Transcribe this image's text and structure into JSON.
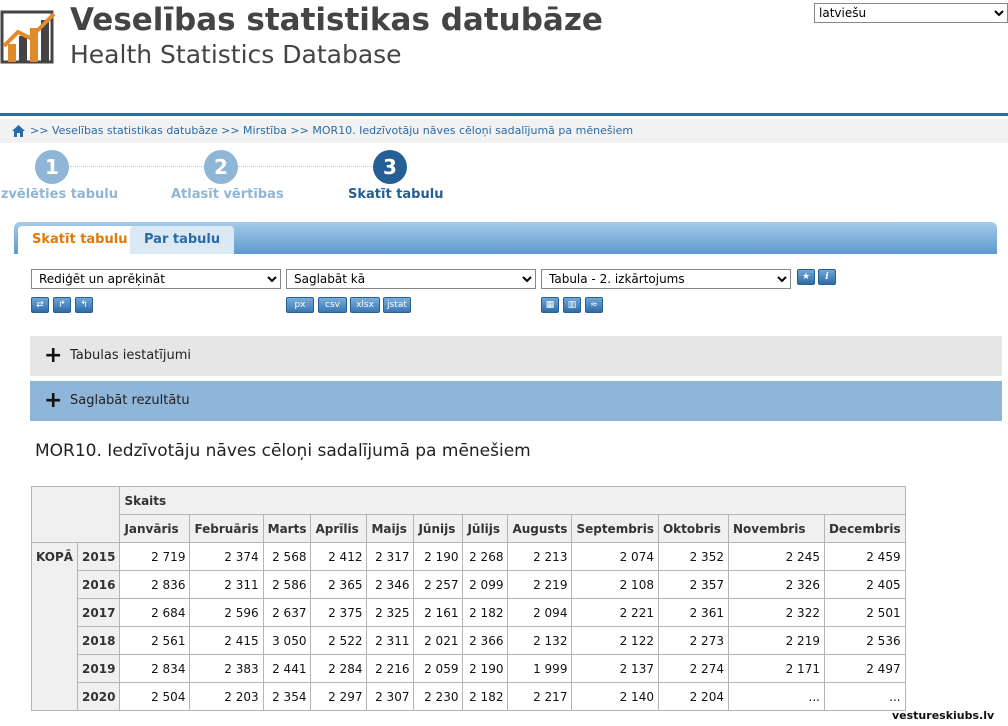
{
  "header": {
    "title_lv": "Veselības statistikas datubāze",
    "title_en": "Health Statistics Database",
    "language_selected": "latviešu"
  },
  "breadcrumb": {
    "path": ">> Veselības statistikas datubāze >> Mirstība >> MOR10. Iedzīvotāju nāves cēloņi sadalījumā pa mēnešiem"
  },
  "steps": [
    {
      "number": "1",
      "label": "Izvēlēties tabulu"
    },
    {
      "number": "2",
      "label": "Atlasīt vērtības"
    },
    {
      "number": "3",
      "label": "Skatīt tabulu"
    }
  ],
  "tabs": {
    "view_table": "Skatīt tabulu",
    "about_table": "Par tabulu"
  },
  "toolbar": {
    "edit_select": "Rediģēt un aprēķināt",
    "save_as_select": "Saglabāt kā",
    "layout_select": "Tabula - 2. izkārtojums",
    "save_formats": [
      "px",
      "csv",
      "xlsx",
      "jstat"
    ]
  },
  "panels": {
    "settings": "Tabulas iestatījumi",
    "save_result": "Saglabāt rezultātu"
  },
  "table": {
    "title": "MOR10. Iedzīvotāju nāves cēloņi sadalījumā pa mēnešiem",
    "measure": "Skaits",
    "group_label": "KOPĀ",
    "months": [
      "Janvāris",
      "Februāris",
      "Marts",
      "Aprīlis",
      "Maijs",
      "Jūnijs",
      "Jūlijs",
      "Augusts",
      "Septembris",
      "Oktobris",
      "Novembris",
      "Decembris"
    ],
    "rows": [
      {
        "year": "2015",
        "values": [
          "2 719",
          "2 374",
          "2 568",
          "2 412",
          "2 317",
          "2 190",
          "2 268",
          "2 213",
          "2 074",
          "2 352",
          "2 245",
          "2 459"
        ]
      },
      {
        "year": "2016",
        "values": [
          "2 836",
          "2 311",
          "2 586",
          "2 365",
          "2 346",
          "2 257",
          "2 099",
          "2 219",
          "2 108",
          "2 357",
          "2 326",
          "2 405"
        ]
      },
      {
        "year": "2017",
        "values": [
          "2 684",
          "2 596",
          "2 637",
          "2 375",
          "2 325",
          "2 161",
          "2 182",
          "2 094",
          "2 221",
          "2 361",
          "2 322",
          "2 501"
        ]
      },
      {
        "year": "2018",
        "values": [
          "2 561",
          "2 415",
          "3 050",
          "2 522",
          "2 311",
          "2 021",
          "2 366",
          "2 132",
          "2 122",
          "2 273",
          "2 219",
          "2 536"
        ]
      },
      {
        "year": "2019",
        "values": [
          "2 834",
          "2 383",
          "2 441",
          "2 284",
          "2 216",
          "2 059",
          "2 190",
          "1 999",
          "2 137",
          "2 274",
          "2 171",
          "2 497"
        ]
      },
      {
        "year": "2020",
        "values": [
          "2 504",
          "2 203",
          "2 354",
          "2 297",
          "2 307",
          "2 230",
          "2 182",
          "2 217",
          "2 140",
          "2 204",
          "...",
          "..."
        ]
      }
    ]
  },
  "watermark": "vestureskiubs.lv",
  "colors": {
    "accent_blue": "#2e6ea6",
    "active_tab_text": "#e07b00",
    "step_inactive": "#8fb6d6",
    "step_active": "#245f95"
  }
}
